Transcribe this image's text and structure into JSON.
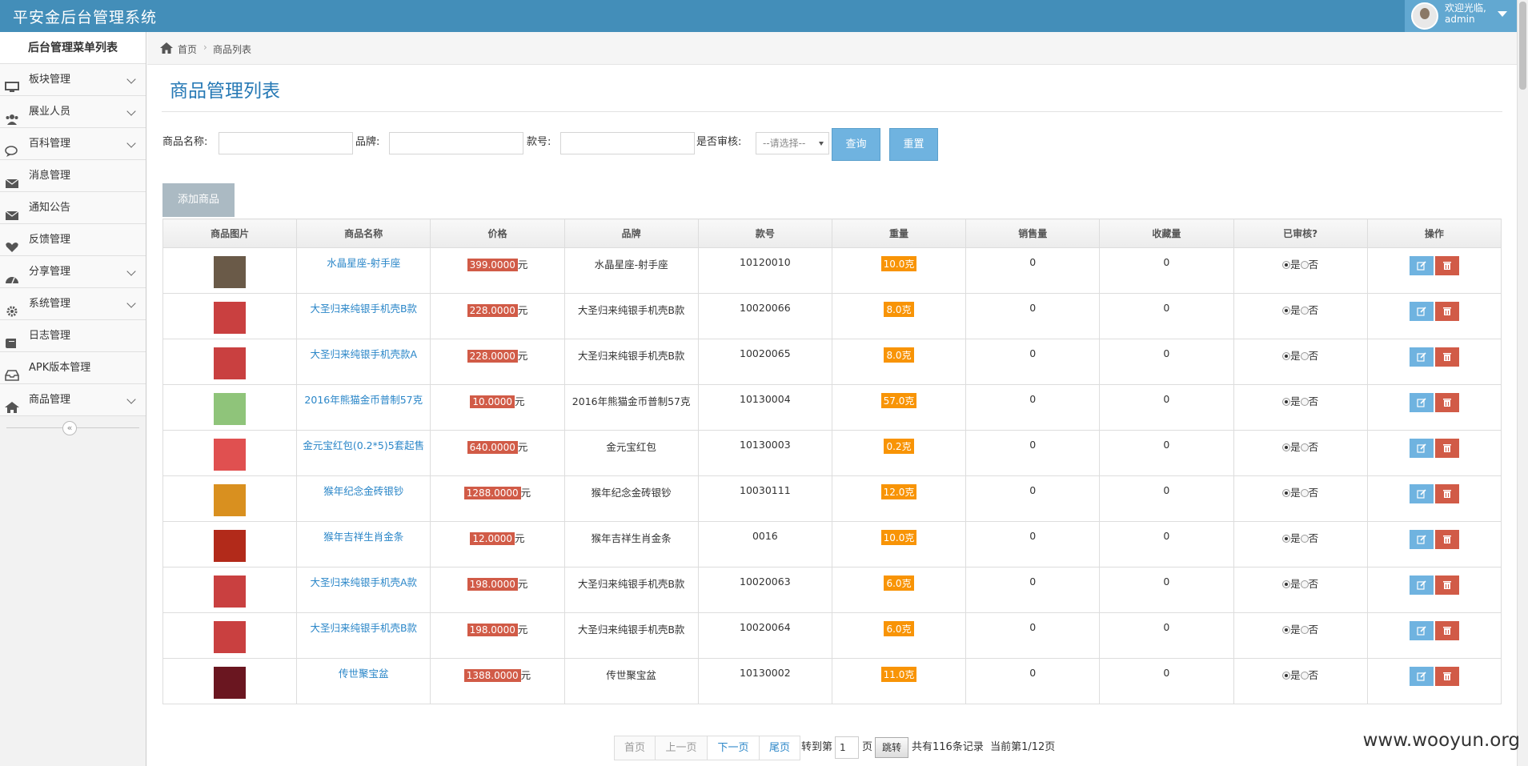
{
  "app": {
    "title": "平安金后台管理系统"
  },
  "user": {
    "welcome": "欢迎光临,",
    "name": "admin"
  },
  "sidebar": {
    "title": "后台管理菜单列表",
    "items": [
      {
        "label": "板块管理",
        "icon": "desktop-icon",
        "expandable": true
      },
      {
        "label": "展业人员",
        "icon": "users-icon",
        "expandable": true
      },
      {
        "label": "百科管理",
        "icon": "comments-icon",
        "expandable": true
      },
      {
        "label": "消息管理",
        "icon": "envelope-icon",
        "expandable": false
      },
      {
        "label": "通知公告",
        "icon": "envelope-icon",
        "expandable": false
      },
      {
        "label": "反馈管理",
        "icon": "heart-icon",
        "expandable": false
      },
      {
        "label": "分享管理",
        "icon": "dashboard-icon",
        "expandable": true
      },
      {
        "label": "系统管理",
        "icon": "gear-icon",
        "expandable": true
      },
      {
        "label": "日志管理",
        "icon": "book-icon",
        "expandable": false
      },
      {
        "label": "APK版本管理",
        "icon": "inbox-icon",
        "expandable": false
      },
      {
        "label": "商品管理",
        "icon": "home-icon",
        "expandable": true
      }
    ],
    "collapse_icon": "double-chevron-left-icon"
  },
  "breadcrumb": {
    "home": "首页",
    "current": "商品列表"
  },
  "page": {
    "title": "商品管理列表"
  },
  "filters": {
    "name_label": "商品名称:",
    "brand_label": "品牌:",
    "model_label": "款号:",
    "audit_label": "是否审核:",
    "audit_select": "--请选择--",
    "query_button": "查询",
    "reset_button": "重置",
    "add_button": "添加商品"
  },
  "table": {
    "headers": [
      "商品图片",
      "商品名称",
      "价格",
      "品牌",
      "款号",
      "重量",
      "销售量",
      "收藏量",
      "已审核?",
      "操作"
    ],
    "currency": "元",
    "yes": "是",
    "no": "否",
    "rows": [
      {
        "name": "水晶星座-射手座",
        "price": "399.0000",
        "brand": "水晶星座-射手座",
        "model": "10120010",
        "weight": "10.0克",
        "sales": "0",
        "favorites": "0",
        "thumb": "#6a5a48"
      },
      {
        "name": "大圣归来纯银手机壳B款",
        "price": "228.0000",
        "brand": "大圣归来纯银手机壳B款",
        "model": "10020066",
        "weight": "8.0克",
        "sales": "0",
        "favorites": "0",
        "thumb": "#c94040"
      },
      {
        "name": "大圣归来纯银手机壳款A",
        "price": "228.0000",
        "brand": "大圣归来纯银手机壳B款",
        "model": "10020065",
        "weight": "8.0克",
        "sales": "0",
        "favorites": "0",
        "thumb": "#c94040"
      },
      {
        "name": "2016年熊猫金币普制57克",
        "price": "10.0000",
        "brand": "2016年熊猫金币普制57克",
        "model": "10130004",
        "weight": "57.0克",
        "sales": "0",
        "favorites": "0",
        "thumb": "#8fc47a"
      },
      {
        "name": "金元宝红包(0.2*5)5套起售",
        "price": "640.0000",
        "brand": "金元宝红包",
        "model": "10130003",
        "weight": "0.2克",
        "sales": "0",
        "favorites": "0",
        "thumb": "#e05050"
      },
      {
        "name": "猴年纪念金砖银钞",
        "price": "1288.0000",
        "brand": "猴年纪念金砖银钞",
        "model": "10030111",
        "weight": "12.0克",
        "sales": "0",
        "favorites": "0",
        "thumb": "#d9901f"
      },
      {
        "name": "猴年吉祥生肖金条",
        "price": "12.0000",
        "brand": "猴年吉祥生肖金条",
        "model": "0016",
        "weight": "10.0克",
        "sales": "0",
        "favorites": "0",
        "thumb": "#b22a1a"
      },
      {
        "name": "大圣归来纯银手机壳A款",
        "price": "198.0000",
        "brand": "大圣归来纯银手机壳B款",
        "model": "10020063",
        "weight": "6.0克",
        "sales": "0",
        "favorites": "0",
        "thumb": "#c94040"
      },
      {
        "name": "大圣归来纯银手机壳B款",
        "price": "198.0000",
        "brand": "大圣归来纯银手机壳B款",
        "model": "10020064",
        "weight": "6.0克",
        "sales": "0",
        "favorites": "0",
        "thumb": "#c94040"
      },
      {
        "name": "传世聚宝盆",
        "price": "1388.0000",
        "brand": "传世聚宝盆",
        "model": "10130002",
        "weight": "11.0克",
        "sales": "0",
        "favorites": "0",
        "thumb": "#6a1620"
      }
    ]
  },
  "pagination": {
    "first": "首页",
    "prev": "上一页",
    "next": "下一页",
    "last": "尾页",
    "goto_prefix": "转到第",
    "page_input": "1",
    "goto_suffix": "页",
    "jump": "跳转",
    "summary": "共有116条记录  当前第1/12页"
  },
  "watermark": "www.wooyun.org"
}
